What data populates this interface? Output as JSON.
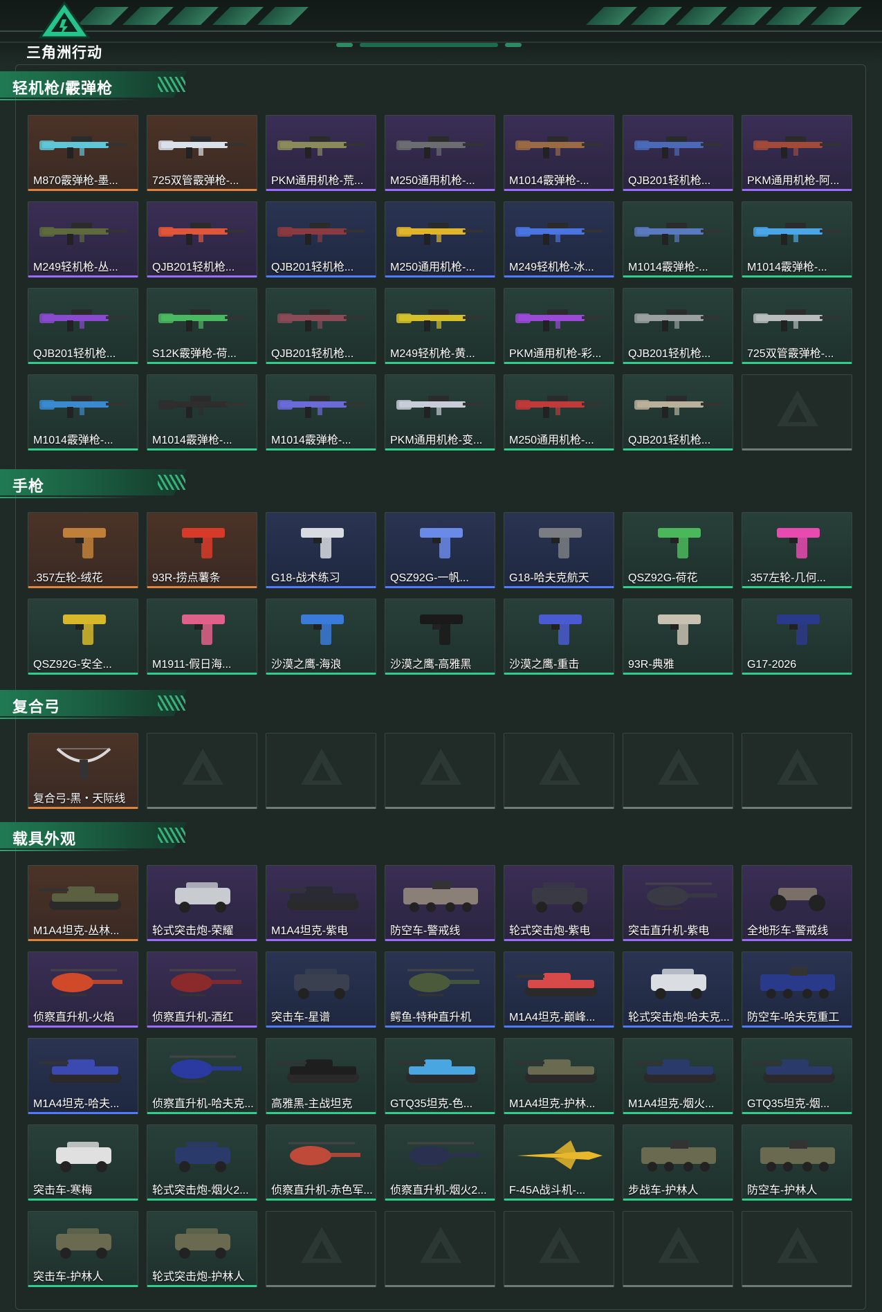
{
  "header": {
    "logo_text": "三角洲行动"
  },
  "sections": [
    {
      "title": "轻机枪/霰弹枪",
      "items": [
        {
          "label": "M870霰弹枪-墨...",
          "rarity": "orange",
          "kind": "gun",
          "color": "#5ec6d6"
        },
        {
          "label": "725双管霰弹枪-...",
          "rarity": "orange",
          "kind": "gun",
          "color": "#d9e1ea"
        },
        {
          "label": "PKM通用机枪-荒...",
          "rarity": "purple",
          "kind": "gun",
          "color": "#8b8a5a"
        },
        {
          "label": "M250通用机枪-...",
          "rarity": "purple",
          "kind": "gun",
          "color": "#6b6d70"
        },
        {
          "label": "M1014霰弹枪-...",
          "rarity": "purple",
          "kind": "gun",
          "color": "#9a6a44"
        },
        {
          "label": "QJB201轻机枪...",
          "rarity": "purple",
          "kind": "gun",
          "color": "#4a6ab8"
        },
        {
          "label": "PKM通用机枪-阿...",
          "rarity": "purple",
          "kind": "gun",
          "color": "#a24a3a"
        },
        {
          "label": "M249轻机枪-丛...",
          "rarity": "purple",
          "kind": "gun",
          "color": "#5e6a3c"
        },
        {
          "label": "QJB201轻机枪...",
          "rarity": "purple",
          "kind": "gun",
          "color": "#e0563a"
        },
        {
          "label": "QJB201轻机枪...",
          "rarity": "blue",
          "kind": "gun",
          "color": "#8a3a40"
        },
        {
          "label": "M250通用机枪-...",
          "rarity": "blue",
          "kind": "gun",
          "color": "#e0b52a"
        },
        {
          "label": "M249轻机枪-冰...",
          "rarity": "blue",
          "kind": "gun",
          "color": "#4a74e0"
        },
        {
          "label": "M1014霰弹枪-...",
          "rarity": "green",
          "kind": "gun",
          "color": "#5a7ac0"
        },
        {
          "label": "M1014霰弹枪-...",
          "rarity": "green",
          "kind": "gun",
          "color": "#4aa6e8"
        },
        {
          "label": "QJB201轻机枪...",
          "rarity": "green",
          "kind": "gun",
          "color": "#8a4ad0"
        },
        {
          "label": "S12K霰弹枪-荷...",
          "rarity": "green",
          "kind": "gun",
          "color": "#4ab860"
        },
        {
          "label": "QJB201轻机枪...",
          "rarity": "green",
          "kind": "gun",
          "color": "#8a4a56"
        },
        {
          "label": "M249轻机枪-黄...",
          "rarity": "green",
          "kind": "gun",
          "color": "#d6c02a"
        },
        {
          "label": "PKM通用机枪-彩...",
          "rarity": "green",
          "kind": "gun",
          "color": "#9a4ad6"
        },
        {
          "label": "QJB201轻机枪...",
          "rarity": "green",
          "kind": "gun",
          "color": "#9aa0a0"
        },
        {
          "label": "725双管霰弹枪-...",
          "rarity": "green",
          "kind": "gun",
          "color": "#b8bcbc"
        },
        {
          "label": "M1014霰弹枪-...",
          "rarity": "green",
          "kind": "gun",
          "color": "#3a8ad0"
        },
        {
          "label": "M1014霰弹枪-...",
          "rarity": "green",
          "kind": "gun",
          "color": "#2e2e2e"
        },
        {
          "label": "M1014霰弹枪-...",
          "rarity": "green",
          "kind": "gun",
          "color": "#6a6ad8"
        },
        {
          "label": "PKM通用机枪-变...",
          "rarity": "green",
          "kind": "gun",
          "color": "#c8ccd8"
        },
        {
          "label": "M250通用机枪-...",
          "rarity": "green",
          "kind": "gun",
          "color": "#c03a3a"
        },
        {
          "label": "QJB201轻机枪...",
          "rarity": "green",
          "kind": "gun",
          "color": "#b8b09a"
        },
        {
          "label": "",
          "rarity": "empty",
          "kind": "empty",
          "color": ""
        }
      ]
    },
    {
      "title": "手枪",
      "items": [
        {
          "label": ".357左轮-绒花",
          "rarity": "orange",
          "kind": "pistol",
          "color": "#c0803a"
        },
        {
          "label": "93R-捞点薯条",
          "rarity": "orange",
          "kind": "pistol",
          "color": "#d83a2a"
        },
        {
          "label": "G18-战术练习",
          "rarity": "blue",
          "kind": "pistol",
          "color": "#d8dce0"
        },
        {
          "label": "QSZ92G-一帆...",
          "rarity": "blue",
          "kind": "pistol",
          "color": "#6a8ae8"
        },
        {
          "label": "G18-哈夫克航天",
          "rarity": "blue",
          "kind": "pistol",
          "color": "#7a7e82"
        },
        {
          "label": "QSZ92G-荷花",
          "rarity": "green",
          "kind": "pistol",
          "color": "#4ab85a"
        },
        {
          "label": ".357左轮-几何...",
          "rarity": "green",
          "kind": "pistol",
          "color": "#e84ab0"
        },
        {
          "label": "QSZ92G-安全...",
          "rarity": "green",
          "kind": "pistol",
          "color": "#d6b82a"
        },
        {
          "label": "M1911-假日海...",
          "rarity": "green",
          "kind": "pistol",
          "color": "#e0608a"
        },
        {
          "label": "沙漠之鹰-海浪",
          "rarity": "green",
          "kind": "pistol",
          "color": "#3a7ad8"
        },
        {
          "label": "沙漠之鹰-高雅黑",
          "rarity": "green",
          "kind": "pistol",
          "color": "#1a1a1a"
        },
        {
          "label": "沙漠之鹰-重击",
          "rarity": "green",
          "kind": "pistol",
          "color": "#4a5ad0"
        },
        {
          "label": "93R-典雅",
          "rarity": "green",
          "kind": "pistol",
          "color": "#c8c0b0"
        },
        {
          "label": "G17-2026",
          "rarity": "green",
          "kind": "pistol",
          "color": "#2a3a8a"
        }
      ]
    },
    {
      "title": "复合弓",
      "items": [
        {
          "label": "复合弓-黑・天际线",
          "rarity": "orange",
          "kind": "bow",
          "color": "#d8d8d8"
        },
        {
          "label": "",
          "rarity": "empty",
          "kind": "empty",
          "color": ""
        },
        {
          "label": "",
          "rarity": "empty",
          "kind": "empty",
          "color": ""
        },
        {
          "label": "",
          "rarity": "empty",
          "kind": "empty",
          "color": ""
        },
        {
          "label": "",
          "rarity": "empty",
          "kind": "empty",
          "color": ""
        },
        {
          "label": "",
          "rarity": "empty",
          "kind": "empty",
          "color": ""
        },
        {
          "label": "",
          "rarity": "empty",
          "kind": "empty",
          "color": ""
        }
      ]
    },
    {
      "title": "载具外观",
      "items": [
        {
          "label": "M1A4坦克-丛林...",
          "rarity": "orange",
          "kind": "tank",
          "color": "#5a6040"
        },
        {
          "label": "轮式突击炮-荣耀",
          "rarity": "purple",
          "kind": "car",
          "color": "#c8ccd0"
        },
        {
          "label": "M1A4坦克-紫电",
          "rarity": "purple",
          "kind": "tank",
          "color": "#2a2a34"
        },
        {
          "label": "防空车-警戒线",
          "rarity": "purple",
          "kind": "apc",
          "color": "#8a8078"
        },
        {
          "label": "轮式突击炮-紫电",
          "rarity": "purple",
          "kind": "car",
          "color": "#3a3a44"
        },
        {
          "label": "突击直升机-紫电",
          "rarity": "purple",
          "kind": "heli",
          "color": "#3a3a44"
        },
        {
          "label": "全地形车-警戒线",
          "rarity": "purple",
          "kind": "atv",
          "color": "#7a7068"
        },
        {
          "label": "侦察直升机-火焰",
          "rarity": "purple",
          "kind": "heli",
          "color": "#d04a2a"
        },
        {
          "label": "侦察直升机-酒红",
          "rarity": "purple",
          "kind": "heli",
          "color": "#8a2a2a"
        },
        {
          "label": "突击车-星谱",
          "rarity": "blue",
          "kind": "car",
          "color": "#3a4050"
        },
        {
          "label": "鳄鱼-特种直升机",
          "rarity": "blue",
          "kind": "heli",
          "color": "#4a5a3a"
        },
        {
          "label": "M1A4坦克-巅峰...",
          "rarity": "blue",
          "kind": "tank",
          "color": "#d84a4a"
        },
        {
          "label": "轮式突击炮-哈夫克...",
          "rarity": "blue",
          "kind": "car",
          "color": "#dadde2"
        },
        {
          "label": "防空车-哈夫克重工",
          "rarity": "blue",
          "kind": "apc",
          "color": "#2a3a8a"
        },
        {
          "label": "M1A4坦克-哈夫...",
          "rarity": "blue",
          "kind": "tank",
          "color": "#3a4ab0"
        },
        {
          "label": "侦察直升机-哈夫克...",
          "rarity": "green",
          "kind": "heli",
          "color": "#2a3aa0"
        },
        {
          "label": "高雅黑-主战坦克",
          "rarity": "green",
          "kind": "tank",
          "color": "#1e1e1e"
        },
        {
          "label": "GTQ35坦克-色...",
          "rarity": "green",
          "kind": "tank",
          "color": "#4aa6e0"
        },
        {
          "label": "M1A4坦克-护林...",
          "rarity": "green",
          "kind": "tank",
          "color": "#6a6a50"
        },
        {
          "label": "M1A4坦克-烟火...",
          "rarity": "green",
          "kind": "tank",
          "color": "#2a3a6a"
        },
        {
          "label": "GTQ35坦克-烟...",
          "rarity": "green",
          "kind": "tank",
          "color": "#2a3a6a"
        },
        {
          "label": "突击车-寒梅",
          "rarity": "green",
          "kind": "car",
          "color": "#e0e0e0"
        },
        {
          "label": "轮式突击炮-烟火2...",
          "rarity": "green",
          "kind": "car",
          "color": "#2a3a6a"
        },
        {
          "label": "侦察直升机-赤色军...",
          "rarity": "green",
          "kind": "heli",
          "color": "#c04a3a"
        },
        {
          "label": "侦察直升机-烟火2...",
          "rarity": "green",
          "kind": "heli",
          "color": "#2a3050"
        },
        {
          "label": "F-45A战斗机-...",
          "rarity": "green",
          "kind": "jet",
          "color": "#e8b82a"
        },
        {
          "label": "步战车-护林人",
          "rarity": "green",
          "kind": "apc",
          "color": "#6a6a50"
        },
        {
          "label": "防空车-护林人",
          "rarity": "green",
          "kind": "apc",
          "color": "#6a6a50"
        },
        {
          "label": "突击车-护林人",
          "rarity": "green",
          "kind": "car",
          "color": "#6a6a50"
        },
        {
          "label": "轮式突击炮-护林人",
          "rarity": "green",
          "kind": "car",
          "color": "#6a6a50"
        },
        {
          "label": "",
          "rarity": "empty",
          "kind": "empty",
          "color": ""
        },
        {
          "label": "",
          "rarity": "empty",
          "kind": "empty",
          "color": ""
        },
        {
          "label": "",
          "rarity": "empty",
          "kind": "empty",
          "color": ""
        },
        {
          "label": "",
          "rarity": "empty",
          "kind": "empty",
          "color": ""
        },
        {
          "label": "",
          "rarity": "empty",
          "kind": "empty",
          "color": ""
        }
      ]
    }
  ]
}
